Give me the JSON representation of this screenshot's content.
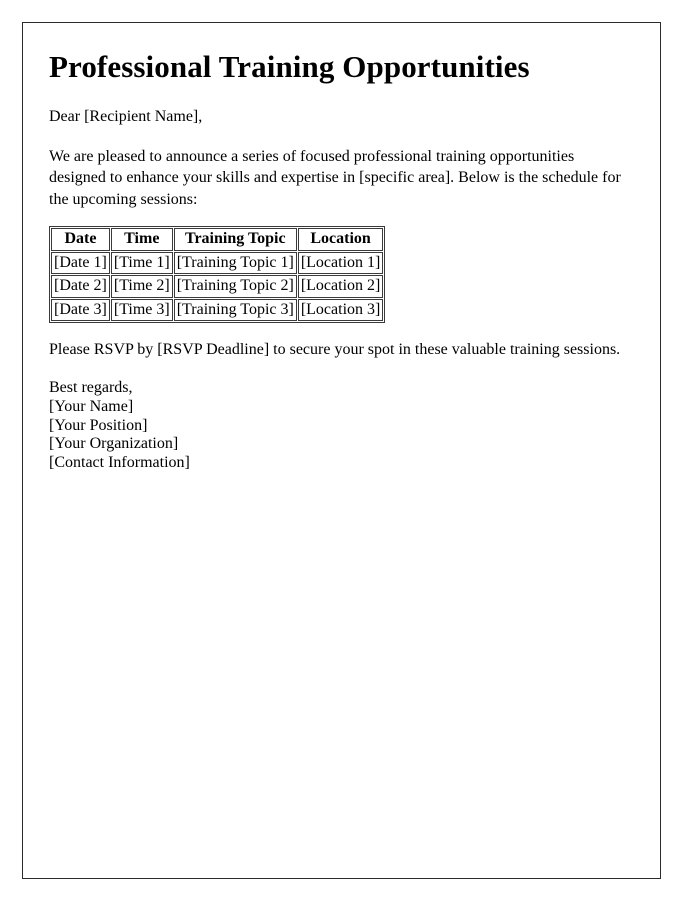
{
  "document": {
    "title": "Professional Training Opportunities",
    "salutation": "Dear [Recipient Name],",
    "intro_paragraph": "We are pleased to announce a series of focused professional training opportunities designed to enhance your skills and expertise in [specific area]. Below is the schedule for the upcoming sessions:",
    "rsvp_paragraph": "Please RSVP by [RSVP Deadline] to secure your spot in these valuable training sessions.",
    "schedule_table": {
      "headers": [
        "Date",
        "Time",
        "Training Topic",
        "Location"
      ],
      "rows": [
        [
          "[Date 1]",
          "[Time 1]",
          "[Training Topic 1]",
          "[Location 1]"
        ],
        [
          "[Date 2]",
          "[Time 2]",
          "[Training Topic 2]",
          "[Location 2]"
        ],
        [
          "[Date 3]",
          "[Time 3]",
          "[Training Topic 3]",
          "[Location 3]"
        ]
      ]
    },
    "signature": {
      "closing": "Best regards,",
      "name": "[Your Name]",
      "position": "[Your Position]",
      "organization": "[Your Organization]",
      "contact": "[Contact Information]"
    }
  },
  "style": {
    "page_border_color": "#2b2b2b",
    "table_border_color": "#3a3a3a",
    "text_color": "#000000",
    "background_color": "#ffffff"
  }
}
